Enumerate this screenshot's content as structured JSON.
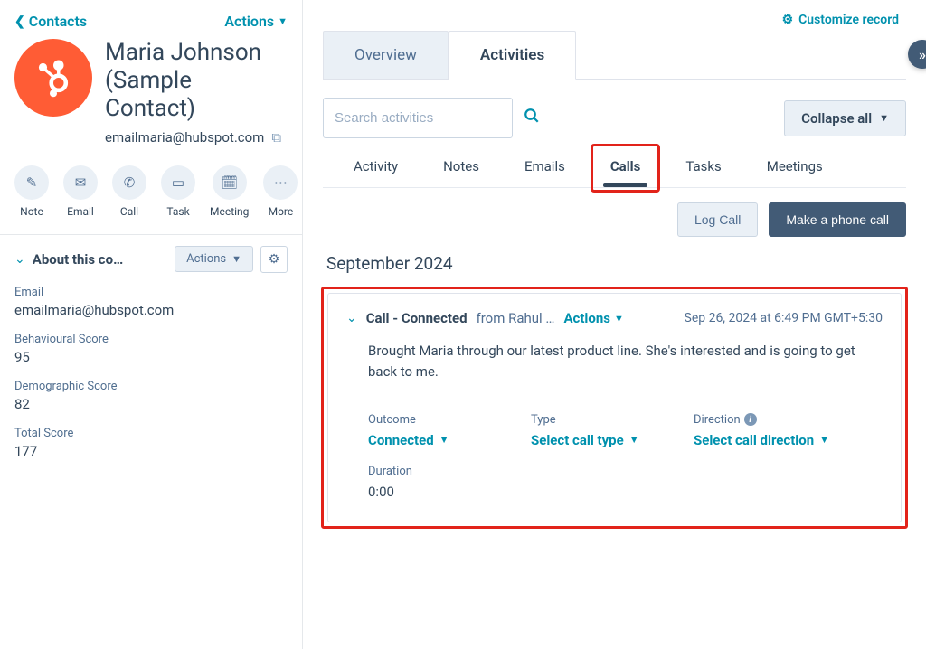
{
  "sidebar": {
    "back_label": "Contacts",
    "actions_label": "Actions",
    "contact_name": "Maria Johnson (Sample Contact)",
    "contact_email": "emailmaria@hubspot.com",
    "quick_actions": {
      "note": "Note",
      "email": "Email",
      "call": "Call",
      "task": "Task",
      "meeting": "Meeting",
      "more": "More"
    },
    "about_title": "About this co…",
    "about_actions_label": "Actions",
    "fields": {
      "email_label": "Email",
      "email_value": "emailmaria@hubspot.com",
      "behavioural_label": "Behavioural Score",
      "behavioural_value": "95",
      "demographic_label": "Demographic Score",
      "demographic_value": "82",
      "total_label": "Total Score",
      "total_value": "177"
    }
  },
  "header": {
    "customize_label": "Customize record",
    "tabs": {
      "overview": "Overview",
      "activities": "Activities"
    }
  },
  "toolbar": {
    "search_placeholder": "Search activities",
    "collapse_label": "Collapse all"
  },
  "subtabs": {
    "activity": "Activity",
    "notes": "Notes",
    "emails": "Emails",
    "calls": "Calls",
    "tasks": "Tasks",
    "meetings": "Meetings"
  },
  "call_actions": {
    "log_call": "Log Call",
    "make_call": "Make a phone call"
  },
  "timeline": {
    "month_label": "September 2024",
    "card": {
      "title": "Call - Connected",
      "from_text": "from Rahul …",
      "actions_label": "Actions",
      "timestamp": "Sep 26, 2024 at 6:49 PM GMT+5:30",
      "body": "Brought Maria through our latest product line. She's interested and is going to get back to me.",
      "outcome_label": "Outcome",
      "outcome_value": "Connected",
      "type_label": "Type",
      "type_value": "Select call type",
      "direction_label": "Direction",
      "direction_value": "Select call direction",
      "duration_label": "Duration",
      "duration_value": "0:00"
    }
  }
}
